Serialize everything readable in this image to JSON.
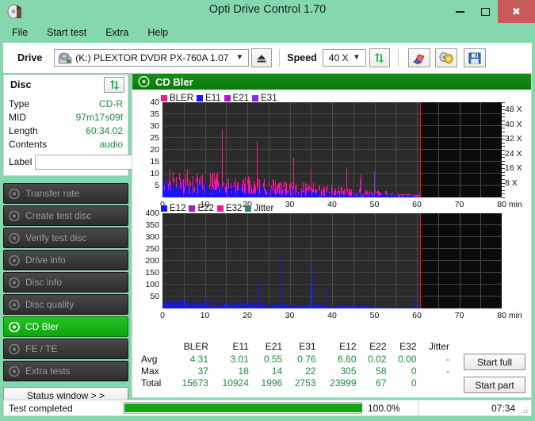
{
  "window": {
    "title": "Opti Drive Control 1.70",
    "app_icon": "disc-icon",
    "buttons": {
      "minimize": "minimize-icon",
      "maximize": "maximize-icon",
      "close": "close-icon"
    }
  },
  "menu": {
    "items": [
      "File",
      "Start test",
      "Extra",
      "Help"
    ]
  },
  "toolbar": {
    "drive_label": "Drive",
    "drive_value": "(K:)   PLEXTOR DVDR   PX-760A 1.07",
    "eject_icon": "eject-icon",
    "speed_label": "Speed",
    "speed_value": "40 X",
    "refresh_icon": "refresh-icon",
    "erase_icon": "erase-icon",
    "discs_icon": "disc-stack-icon",
    "save_icon": "save-icon"
  },
  "disc": {
    "header": "Disc",
    "refresh_icon": "refresh-icon",
    "rows": [
      {
        "key": "Type",
        "value": "CD-R"
      },
      {
        "key": "MID",
        "value": "97m17s09f"
      },
      {
        "key": "Length",
        "value": "60:34.02"
      },
      {
        "key": "Contents",
        "value": "audio"
      }
    ],
    "label_key": "Label",
    "label_value": "",
    "label_placeholder": "",
    "cd_icon": "cd-icon"
  },
  "nav": {
    "items": [
      {
        "label": "Transfer rate",
        "icon": "disc-icon",
        "active": false
      },
      {
        "label": "Create test disc",
        "icon": "disc-icon",
        "active": false
      },
      {
        "label": "Verify test disc",
        "icon": "disc-icon",
        "active": false
      },
      {
        "label": "Drive info",
        "icon": "disc-icon",
        "active": false
      },
      {
        "label": "Disc info",
        "icon": "disc-icon",
        "active": false
      },
      {
        "label": "Disc quality",
        "icon": "disc-icon",
        "active": false
      },
      {
        "label": "CD Bler",
        "icon": "disc-icon",
        "active": true
      },
      {
        "label": "FE / TE",
        "icon": "disc-icon",
        "active": false
      },
      {
        "label": "Extra tests",
        "icon": "disc-icon",
        "active": false
      }
    ],
    "status_window": "Status window > >"
  },
  "panel": {
    "title": "CD Bler",
    "icon": "disc-icon"
  },
  "actions": {
    "start_full": "Start full",
    "start_part": "Start part"
  },
  "statusbar": {
    "message": "Test completed",
    "progress_pct": "100.0%",
    "progress_value": 100,
    "elapsed": "07:34",
    "grip_icon": "resize-grip-icon"
  },
  "stats": {
    "columns": [
      "BLER",
      "E11",
      "E21",
      "E31",
      "E12",
      "E22",
      "E32",
      "Jitter"
    ],
    "rows": [
      {
        "label": "Avg",
        "values": [
          "4.31",
          "3.01",
          "0.55",
          "0.76",
          "6.60",
          "0.02",
          "0.00",
          "-"
        ]
      },
      {
        "label": "Max",
        "values": [
          "37",
          "18",
          "14",
          "22",
          "305",
          "58",
          "0",
          "-"
        ]
      },
      {
        "label": "Total",
        "values": [
          "15673",
          "10924",
          "1996",
          "2753",
          "23999",
          "67",
          "0",
          ""
        ]
      }
    ]
  },
  "chart_data": [
    {
      "type": "area",
      "id": "bler-chart",
      "title": "CD Bler",
      "xlabel": "min",
      "ylabel": "",
      "xlim": [
        0,
        80
      ],
      "ylim": [
        0,
        40
      ],
      "xticks": [
        0,
        10,
        20,
        30,
        40,
        50,
        60,
        70,
        80
      ],
      "xtick_labels": [
        "0",
        "10",
        "20",
        "30",
        "40",
        "50",
        "60",
        "70",
        "80 min"
      ],
      "yticks": [
        5,
        10,
        15,
        20,
        25,
        30,
        35,
        40
      ],
      "secondary_axis": {
        "label": "X",
        "ticks": [
          8,
          16,
          24,
          32,
          40,
          48
        ],
        "tick_labels": [
          "8 X",
          "16 X",
          "24 X",
          "32 X",
          "40 X",
          "48 X"
        ],
        "lim": [
          0,
          52
        ]
      },
      "grid": true,
      "legend_position": "top-left",
      "data_end_marker_x": 60.7,
      "data_end_marker_color": "#e21414",
      "series": [
        {
          "name": "BLER",
          "color": "#ff1493",
          "avg": 4.31,
          "max": 37,
          "total": 15673
        },
        {
          "name": "E11",
          "color": "#1414ff",
          "avg": 3.01,
          "max": 18,
          "total": 10924
        },
        {
          "name": "E21",
          "color": "#b414d2",
          "avg": 0.55,
          "max": 14,
          "total": 1996
        },
        {
          "name": "E31",
          "color": "#8a2be2",
          "avg": 0.76,
          "max": 22,
          "total": 2753
        }
      ]
    },
    {
      "type": "area",
      "id": "e12-chart",
      "title": "",
      "xlabel": "min",
      "ylabel": "",
      "xlim": [
        0,
        80
      ],
      "ylim": [
        0,
        400
      ],
      "xticks": [
        0,
        10,
        20,
        30,
        40,
        50,
        60,
        70,
        80
      ],
      "xtick_labels": [
        "0",
        "10",
        "20",
        "30",
        "40",
        "50",
        "60",
        "70",
        "80 min"
      ],
      "yticks": [
        50,
        100,
        150,
        200,
        250,
        300,
        350,
        400
      ],
      "grid": true,
      "legend_position": "top-left",
      "data_end_marker_x": 60.7,
      "data_end_marker_color": "#e21414",
      "series": [
        {
          "name": "E12",
          "color": "#1414ff",
          "avg": 6.6,
          "max": 305,
          "total": 23999
        },
        {
          "name": "E22",
          "color": "#b414d2",
          "avg": 0.02,
          "max": 58,
          "total": 67
        },
        {
          "name": "E32",
          "color": "#ff1493",
          "avg": 0.0,
          "max": 0,
          "total": 0
        },
        {
          "name": "Jitter",
          "color": "#3e7d7d",
          "avg": null,
          "max": null,
          "total": null
        }
      ]
    }
  ],
  "colors": {
    "accent_green": "#13a313",
    "window_chrome": "#85d8ae",
    "plot_background": "#2b2b2b",
    "value_text": "#1f8a3c"
  }
}
